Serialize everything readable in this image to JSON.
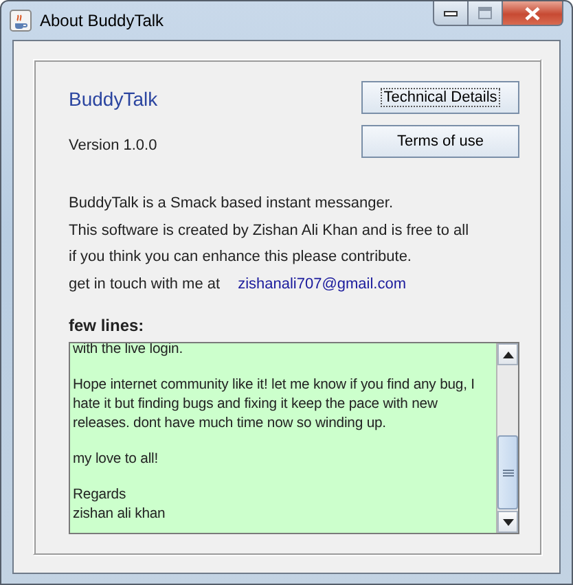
{
  "window": {
    "title": "About BuddyTalk"
  },
  "app_name": "BuddyTalk",
  "version": "Version 1.0.0",
  "buttons": [
    {
      "label": "Technical Details",
      "focused": true
    },
    {
      "label": "Terms of use",
      "focused": false
    }
  ],
  "description": [
    "BuddyTalk is a Smack based instant messanger.",
    "This software is created by Zishan Ali Khan and is free to all",
    "if you think you can enhance this please contribute."
  ],
  "contact": {
    "label": "get in touch with me at",
    "email": "zishanali707@gmail.com"
  },
  "notes": {
    "label": "few lines:",
    "paragraphs": [
      {
        "lines": [
          "with the live login."
        ]
      },
      {
        "lines": [
          "Hope internet community like it! let me know if you find any bug, I",
          "hate it but finding bugs and fixing it keep the pace with new",
          "releases. dont have much time now so winding up."
        ]
      },
      {
        "lines": [
          "my love to all!"
        ]
      },
      {
        "lines": [
          "Regards",
          "zishan ali khan"
        ]
      }
    ]
  }
}
